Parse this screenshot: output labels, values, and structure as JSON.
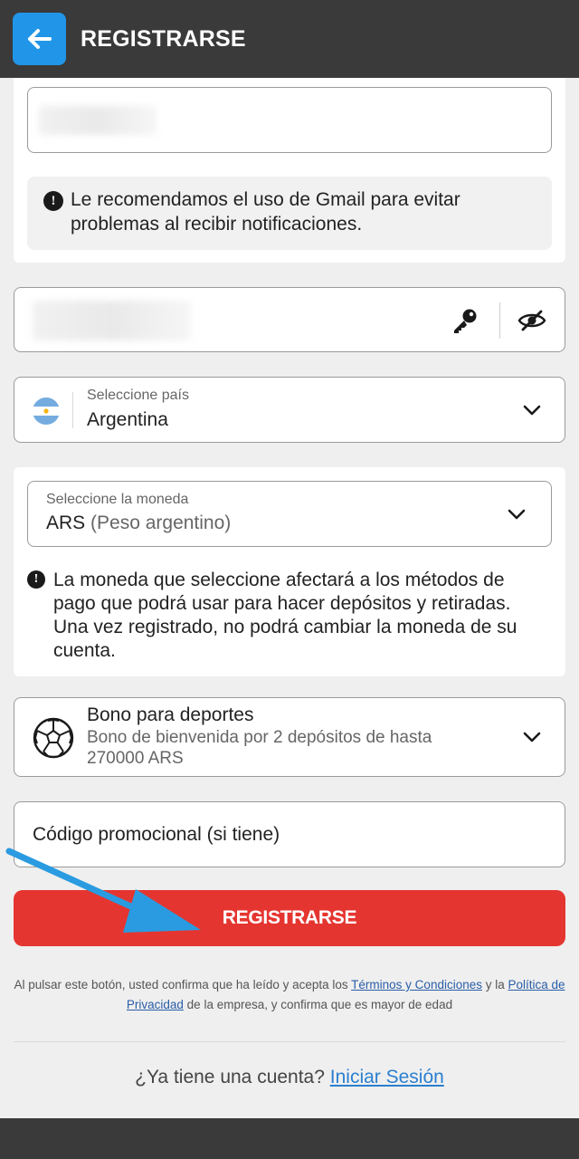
{
  "header": {
    "title": "REGISTRARSE",
    "back_icon": "arrow-left-icon"
  },
  "email_section": {
    "info": "Le recomendamos el uso de Gmail para evitar problemas al recibir notificaciones.",
    "info_line1": "Le recomendamos el uso de Gmail para evitar",
    "info_line2": "problemas al recibir notificaciones."
  },
  "password": {
    "key_icon": "key-icon",
    "toggle_icon": "eye-slash-icon"
  },
  "country": {
    "label": "Seleccione país",
    "value": "Argentina",
    "flag_icon": "argentina-flag-icon"
  },
  "currency": {
    "label": "Seleccione la moneda",
    "value_code": "ARS",
    "value_name": "(Peso argentino)",
    "info_line1": "La moneda que seleccione afectará a los métodos de",
    "info_line2": "pago que podrá usar para hacer depósitos y retiradas.",
    "info_line3": "Una vez registrado, no podrá cambiar la moneda de su",
    "info_line4": "cuenta."
  },
  "bonus": {
    "title": "Bono para deportes",
    "desc_line1": "Bono de bienvenida por 2 depósitos de hasta",
    "desc_line2": "270000 ARS",
    "icon": "soccer-ball-icon"
  },
  "promo": {
    "placeholder": "Código promocional (si tiene)"
  },
  "submit": {
    "label": "REGISTRARSE"
  },
  "legal": {
    "part1": "Al pulsar este botón, usted confirma que ha leído y acepta los ",
    "terms_link": "Términos y Condiciones",
    "part2": " y la ",
    "privacy_link": "Política de Privacidad",
    "part3": " de la empresa, y confirma que es mayor de edad"
  },
  "login": {
    "prompt": "¿Ya tiene una cuenta? ",
    "link": "Iniciar Sesión"
  },
  "colors": {
    "header_bg": "#3a3a3a",
    "accent_blue": "#2196e8",
    "cta_red": "#e53530",
    "annotation_arrow": "#2a9be0"
  }
}
